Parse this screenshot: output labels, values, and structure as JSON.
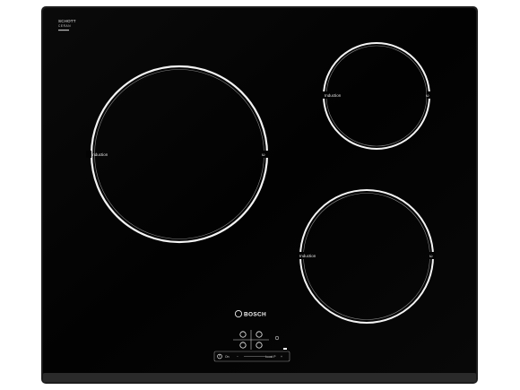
{
  "cooktop": {
    "glass_color": "#030303",
    "frame_color": "#1c1c1c",
    "line_color": "#f4f4f4",
    "glass_logo": {
      "line1": "SCHOTT",
      "line2": "CERAN"
    },
    "brand": "BOSCH",
    "zones": [
      {
        "name": "large-left",
        "label": "Induction"
      },
      {
        "name": "small-top-right",
        "label": "Induction"
      },
      {
        "name": "medium-bottom-right",
        "label": "Induction"
      }
    ],
    "controls": {
      "power_label": "On",
      "boost_label": "boost P"
    }
  }
}
